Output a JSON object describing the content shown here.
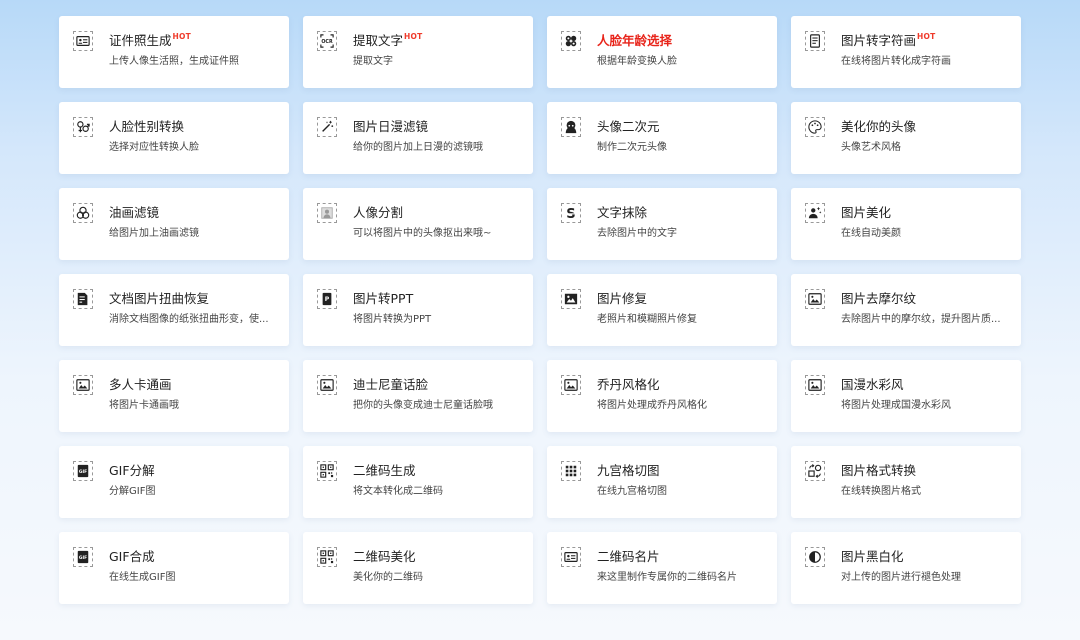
{
  "tools": [
    {
      "title": "证件照生成",
      "desc": "上传人像生活照，生成证件照",
      "hot": "HOT",
      "icon": "id-card-icon"
    },
    {
      "title": "提取文字",
      "desc": "提取文字",
      "hot": "HOT",
      "icon": "ocr-icon"
    },
    {
      "title": "人脸年龄选择",
      "desc": "根据年龄变换人脸",
      "highlight": true,
      "icon": "face-age-icon"
    },
    {
      "title": "图片转字符画",
      "desc": "在线将图片转化成字符画",
      "hot": "HOT",
      "icon": "text-document-icon"
    },
    {
      "title": "人脸性别转换",
      "desc": "选择对应性转换人脸",
      "icon": "gender-icon"
    },
    {
      "title": "图片日漫滤镜",
      "desc": "给你的图片加上日漫的滤镜哦",
      "icon": "magic-wand-icon"
    },
    {
      "title": "头像二次元",
      "desc": "制作二次元头像",
      "icon": "anime-avatar-icon"
    },
    {
      "title": "美化你的头像",
      "desc": "头像艺术风格",
      "icon": "palette-icon"
    },
    {
      "title": "油画滤镜",
      "desc": "给图片加上油画滤镜",
      "icon": "oil-paint-icon"
    },
    {
      "title": "人像分割",
      "desc": "可以将图片中的头像抠出来哦~",
      "icon": "portrait-cutout-icon"
    },
    {
      "title": "文字抹除",
      "desc": "去除图片中的文字",
      "icon": "text-erase-icon"
    },
    {
      "title": "图片美化",
      "desc": "在线自动美颜",
      "icon": "beauty-icon"
    },
    {
      "title": "文档图片扭曲恢复",
      "desc": "消除文档图像的纸张扭曲形变，使...",
      "icon": "document-fix-icon"
    },
    {
      "title": "图片转PPT",
      "desc": "将图片转换为PPT",
      "icon": "ppt-icon"
    },
    {
      "title": "图片修复",
      "desc": "老照片和模糊照片修复",
      "icon": "photo-repair-icon"
    },
    {
      "title": "图片去摩尔纹",
      "desc": "去除图片中的摩尔纹，提升图片质...",
      "icon": "image-icon"
    },
    {
      "title": "多人卡通画",
      "desc": "将图片卡通画哦",
      "icon": "image-icon"
    },
    {
      "title": "迪士尼童话脸",
      "desc": "把你的头像变成迪士尼童话脸哦",
      "icon": "image-icon"
    },
    {
      "title": "乔丹风格化",
      "desc": "将图片处理成乔丹风格化",
      "icon": "image-icon"
    },
    {
      "title": "国漫水彩风",
      "desc": "将图片处理成国漫水彩风",
      "icon": "image-icon"
    },
    {
      "title": "GIF分解",
      "desc": "分解GIF图",
      "icon": "gif-icon"
    },
    {
      "title": "二维码生成",
      "desc": "将文本转化成二维码",
      "icon": "qr-code-icon"
    },
    {
      "title": "九宫格切图",
      "desc": "在线九宫格切图",
      "icon": "grid-nine-icon"
    },
    {
      "title": "图片格式转换",
      "desc": "在线转换图片格式",
      "icon": "format-convert-icon"
    },
    {
      "title": "GIF合成",
      "desc": "在线生成GIF图",
      "icon": "gif-icon"
    },
    {
      "title": "二维码美化",
      "desc": "美化你的二维码",
      "icon": "qr-code-icon"
    },
    {
      "title": "二维码名片",
      "desc": "来这里制作专属你的二维码名片",
      "icon": "id-card-icon"
    },
    {
      "title": "图片黑白化",
      "desc": "对上传的图片进行褪色处理",
      "icon": "contrast-icon"
    }
  ],
  "colors": {
    "title": "#222222",
    "highlight": "#e8241a",
    "hot": "#ef3b2b",
    "desc": "#444444"
  }
}
